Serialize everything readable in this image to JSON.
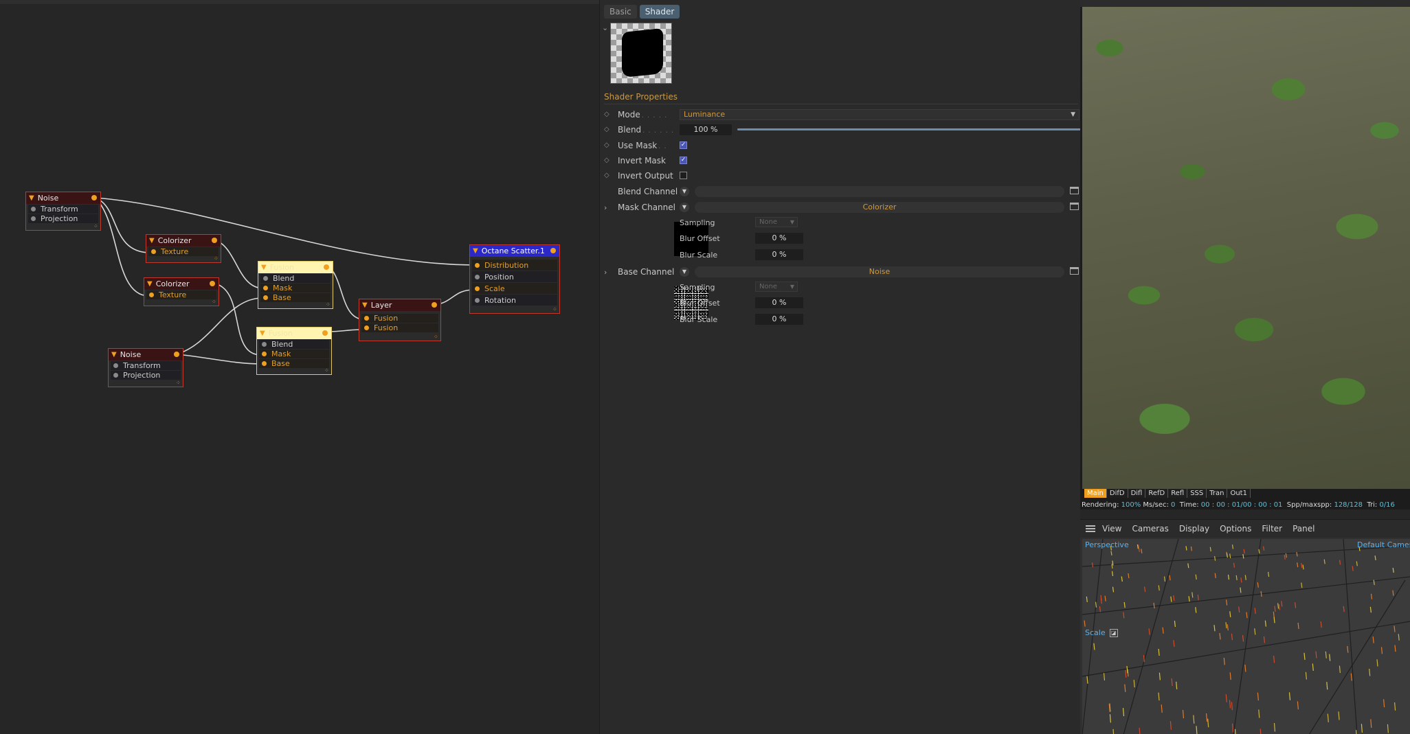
{
  "node_editor": {
    "nodes": {
      "noise1": {
        "title": "Noise",
        "ports": [
          "Transform",
          "Projection"
        ]
      },
      "colorizer1": {
        "title": "Colorizer",
        "ports": [
          "Texture"
        ]
      },
      "colorizer2": {
        "title": "Colorizer",
        "ports": [
          "Texture"
        ]
      },
      "noise2": {
        "title": "Noise",
        "ports": [
          "Transform",
          "Projection"
        ]
      },
      "fusion1": {
        "title": "Fusion",
        "ports": [
          "Blend",
          "Mask",
          "Base"
        ]
      },
      "fusion2": {
        "title": "Fusion",
        "ports": [
          "Blend",
          "Mask",
          "Base"
        ]
      },
      "layer": {
        "title": "Layer",
        "ports": [
          "Fusion",
          "Fusion"
        ]
      },
      "scatter": {
        "title": "Octane Scatter.1",
        "ports": [
          "Distribution",
          "Position",
          "Scale",
          "Rotation"
        ]
      }
    }
  },
  "attributes": {
    "tabs": [
      "Basic",
      "Shader"
    ],
    "active_tab": "Shader",
    "section_title": "Shader Properties",
    "mode": {
      "label": "Mode",
      "value": "Luminance"
    },
    "blend": {
      "label": "Blend",
      "value": "100 %",
      "fraction": 1.0
    },
    "use_mask": {
      "label": "Use Mask",
      "checked": true
    },
    "invert_mask": {
      "label": "Invert Mask",
      "checked": true
    },
    "invert_output": {
      "label": "Invert Output",
      "checked": false
    },
    "blend_channel": {
      "label": "Blend Channel",
      "value": ""
    },
    "mask_channel": {
      "label": "Mask Channel",
      "value": "Colorizer",
      "sampling_label": "Sampling",
      "sampling": "None",
      "blur_offset_label": "Blur Offset",
      "blur_offset": "0 %",
      "blur_scale_label": "Blur Scale",
      "blur_scale": "0 %"
    },
    "base_channel": {
      "label": "Base Channel",
      "value": "Noise",
      "sampling_label": "Sampling",
      "sampling": "None",
      "blur_offset_label": "Blur Offset",
      "blur_offset": "0 %",
      "blur_scale_label": "Blur Scale",
      "blur_scale": "0 %"
    }
  },
  "render_view": {
    "pass_tabs": [
      "Main",
      "DifD",
      "Difl",
      "RefD",
      "Refl",
      "SSS",
      "Tran",
      "Out1"
    ],
    "active_pass": "Main",
    "status": {
      "rendering_label": "Rendering:",
      "rendering": "100%",
      "ms_label": "Ms/sec:",
      "ms": "0",
      "time_label": "Time:",
      "time": "00 : 00 : 01/00 : 00 : 01",
      "spp_label": "Spp/maxspp:",
      "spp": "128/128",
      "tri_label": "Tri:",
      "tri": "0/16"
    }
  },
  "viewport": {
    "menu": [
      "View",
      "Cameras",
      "Display",
      "Options",
      "Filter",
      "Panel"
    ],
    "projection": "Perspective",
    "camera": "Default Camera",
    "hud_scale": "Scale"
  },
  "colors": {
    "accent_orange": "#f0a020",
    "node_border": "#c0392b",
    "scatter_header": "#2c28c8",
    "fusion_header": "#fff5b0",
    "hud_blue": "#5fb0e6"
  }
}
